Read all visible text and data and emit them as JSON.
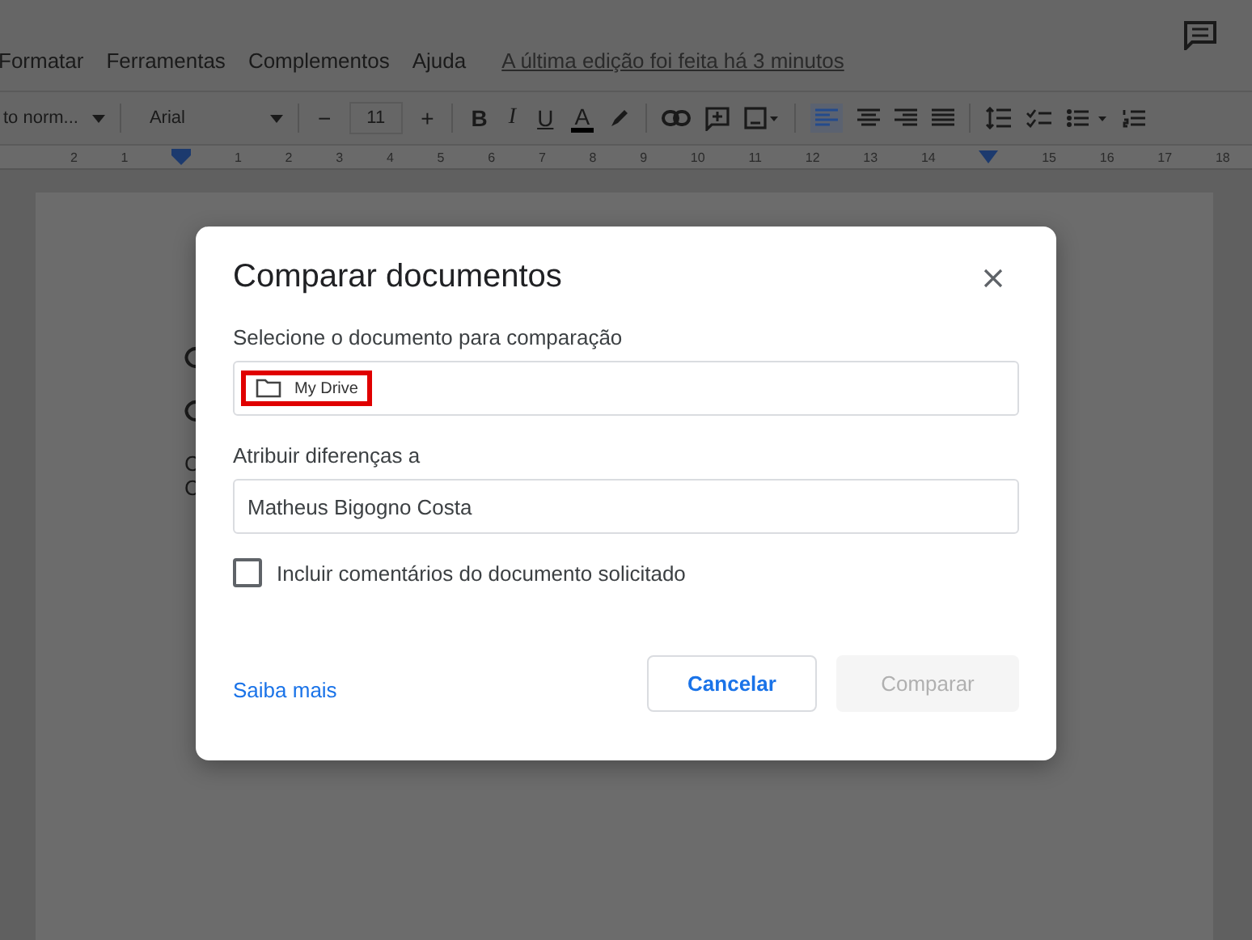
{
  "menu": {
    "items": [
      "Formatar",
      "Ferramentas",
      "Complementos",
      "Ajuda"
    ],
    "last_edit": "A última edição foi feita há 3 minutos"
  },
  "toolbar": {
    "style": "to norm...",
    "font": "Arial",
    "minus": "−",
    "font_size": "11",
    "plus": "+",
    "bold": "B",
    "italic": "I",
    "underline": "U",
    "text_color": "A"
  },
  "ruler": [
    "2",
    "1",
    "1",
    "2",
    "3",
    "4",
    "5",
    "6",
    "7",
    "8",
    "9",
    "10",
    "11",
    "12",
    "13",
    "14",
    "15",
    "16",
    "17",
    "18"
  ],
  "document": {
    "lines": [
      "C",
      "C"
    ]
  },
  "dialog": {
    "title": "Comparar documentos",
    "select_label": "Selecione o documento para comparação",
    "select_value": "My Drive",
    "select_highlighted": true,
    "attribute_label": "Atribuir diferenças a",
    "attribute_value": "Matheus Bigogno Costa",
    "include_comments": {
      "label": "Incluir comentários do documento solicitado",
      "checked": false
    },
    "learn_more": "Saiba mais",
    "cancel": "Cancelar",
    "compare": {
      "label": "Comparar",
      "disabled": true
    }
  }
}
